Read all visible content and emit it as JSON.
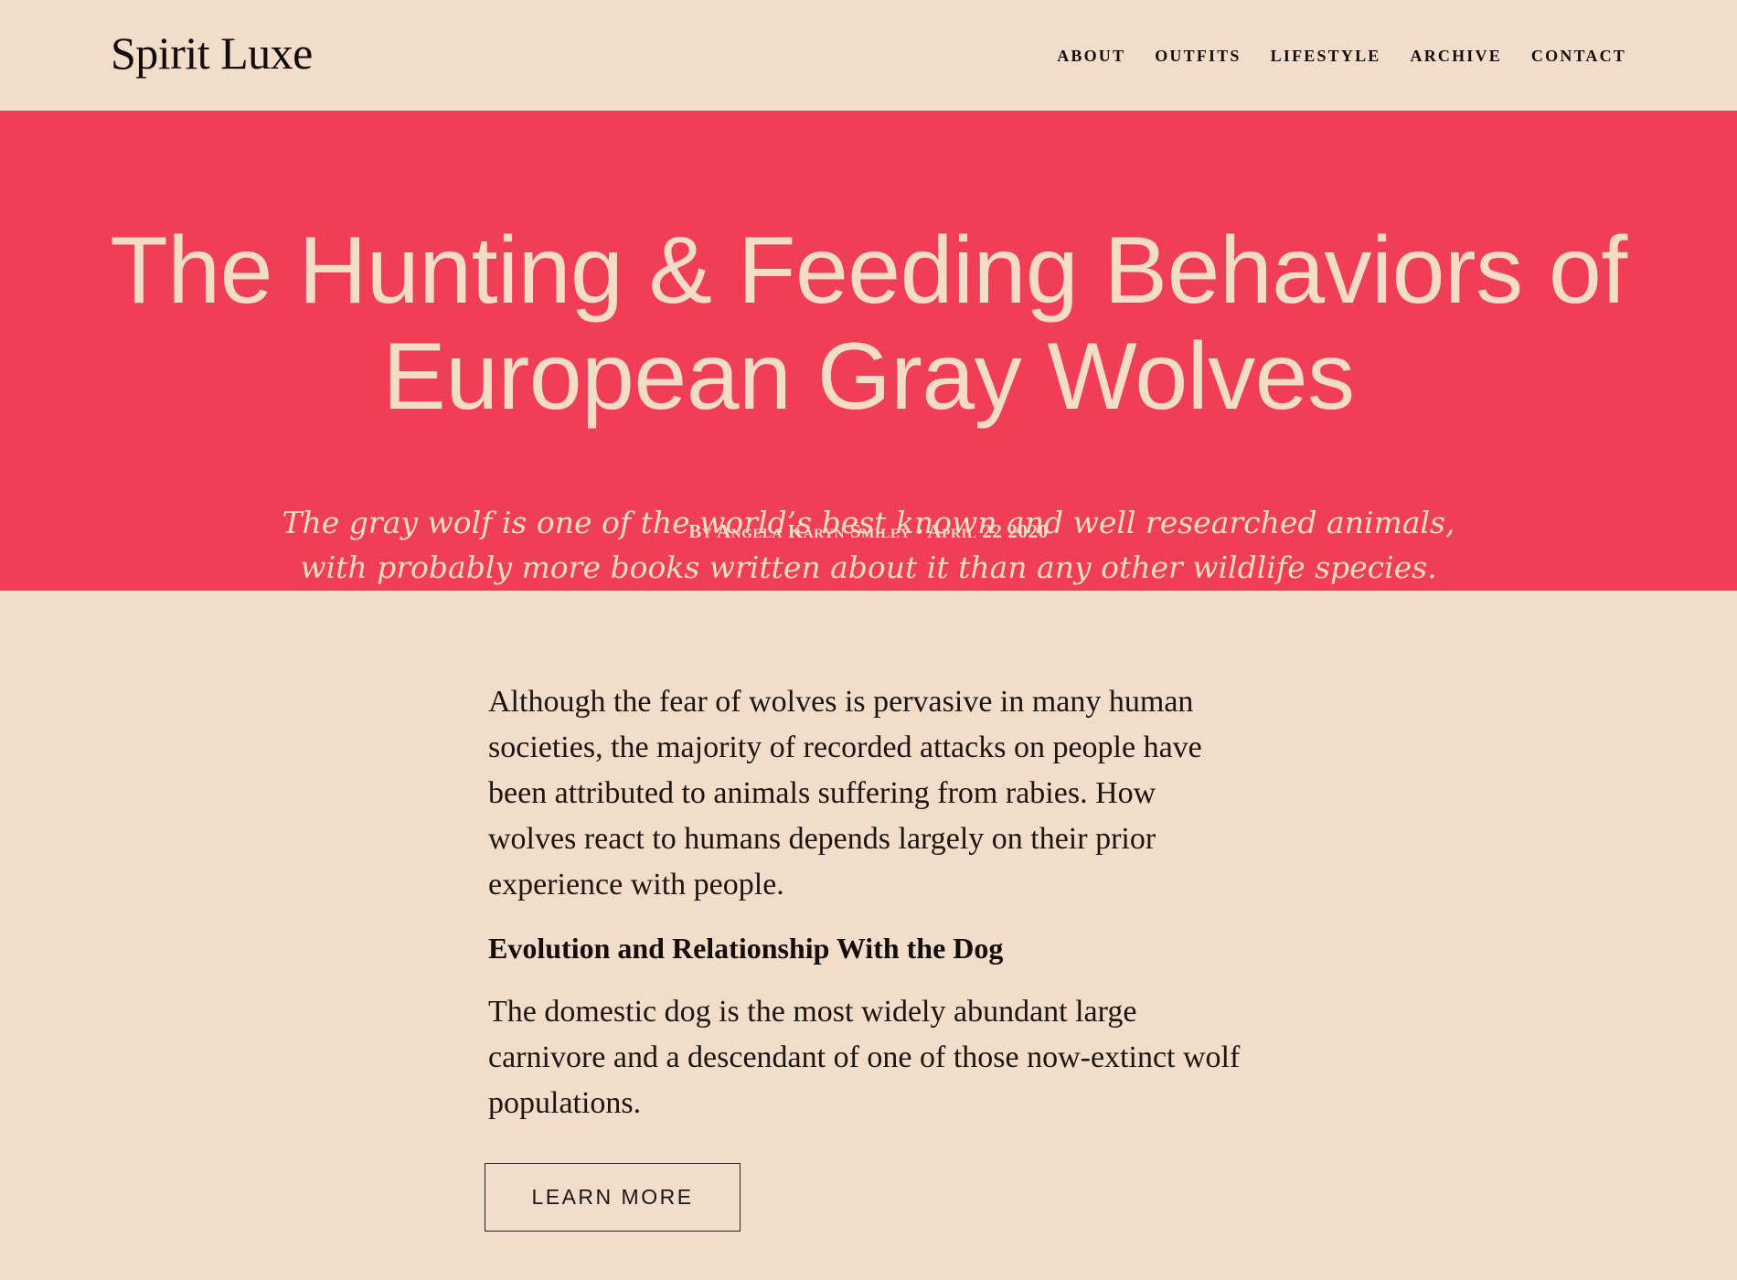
{
  "site": {
    "brand": "Spirit Luxe"
  },
  "nav": {
    "items": [
      {
        "label": "About"
      },
      {
        "label": "Outfits"
      },
      {
        "label": "Lifestyle"
      },
      {
        "label": "Archive"
      },
      {
        "label": "Contact"
      }
    ]
  },
  "hero": {
    "title": "The Hunting & Feeding Behaviors of European Gray Wolves",
    "subtitle": "The gray wolf is one of the world’s best known and well researched animals, with probably more books written about it than any other wildlife species.",
    "byline": "By Angela Karyn Smiley • April 22 2020"
  },
  "article": {
    "paragraph_1": "Although the fear of wolves is pervasive in many human societies, the majority of recorded attacks on people have been attributed to animals suffering from rabies. How wolves react to humans depends largely on their prior experience with people.",
    "heading": "Evolution and Relationship With the Dog",
    "paragraph_2": "The domestic dog is the most widely abundant large carnivore and a descendant of one of those now-extinct wolf populations.",
    "cta_label": "Learn More"
  },
  "colors": {
    "page_background": "#f1ddc9",
    "hero_background": "#ef3e56",
    "hero_text": "#f4dcc6",
    "body_text": "#1c1512"
  }
}
